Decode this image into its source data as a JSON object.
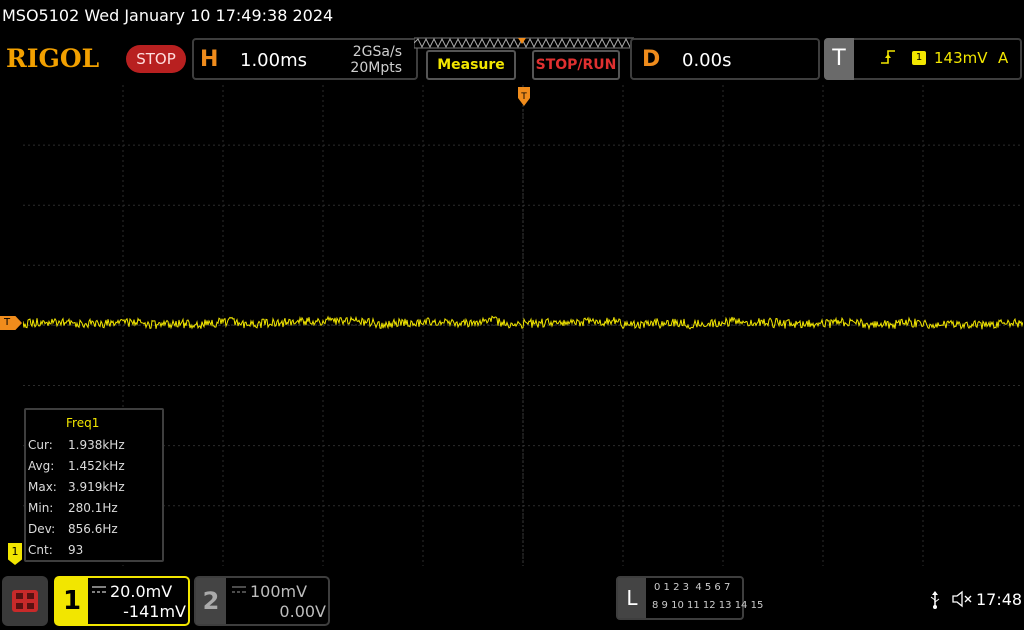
{
  "status_line": "MSO5102  Wed January 10 17:49:38 2024",
  "header": {
    "logo": "RIGOL",
    "run_state": "STOP",
    "horizontal": {
      "letter": "H",
      "timebase": "1.00ms",
      "sample_rate": "2GSa/s",
      "memory_depth": "20Mpts"
    },
    "measure_button": "Measure",
    "stop_run_button": "STOP/RUN",
    "delay": {
      "letter": "D",
      "value": "0.00s"
    },
    "trigger": {
      "letter": "T",
      "source": "1",
      "level": "143mV",
      "mode": "A"
    }
  },
  "markers": {
    "trigger_level": "T",
    "channel1": "1"
  },
  "measurement": {
    "title": "Freq1",
    "rows": [
      {
        "label": "Cur:",
        "value": "1.938kHz"
      },
      {
        "label": "Avg:",
        "value": "1.452kHz"
      },
      {
        "label": "Max:",
        "value": "3.919kHz"
      },
      {
        "label": "Min:",
        "value": "280.1Hz"
      },
      {
        "label": "Dev:",
        "value": "856.6Hz"
      },
      {
        "label": "Cnt:",
        "value": "93"
      }
    ]
  },
  "channels": {
    "ch1": {
      "num": "1",
      "scale": "20.0mV",
      "offset": "-141mV",
      "color": "#f2e600"
    },
    "ch2": {
      "num": "2",
      "scale": "100mV",
      "offset": "0.00V",
      "color": "#bdbdbd"
    }
  },
  "logic": {
    "letter": "L",
    "row1": "0 1 2 3  4 5 6 7",
    "row2": "8 9 10 11 12 13 14 15"
  },
  "clock": "17:48",
  "colors": {
    "accent": "#f08c1c",
    "trace": "#f2e600",
    "stop": "#c72a2a"
  }
}
